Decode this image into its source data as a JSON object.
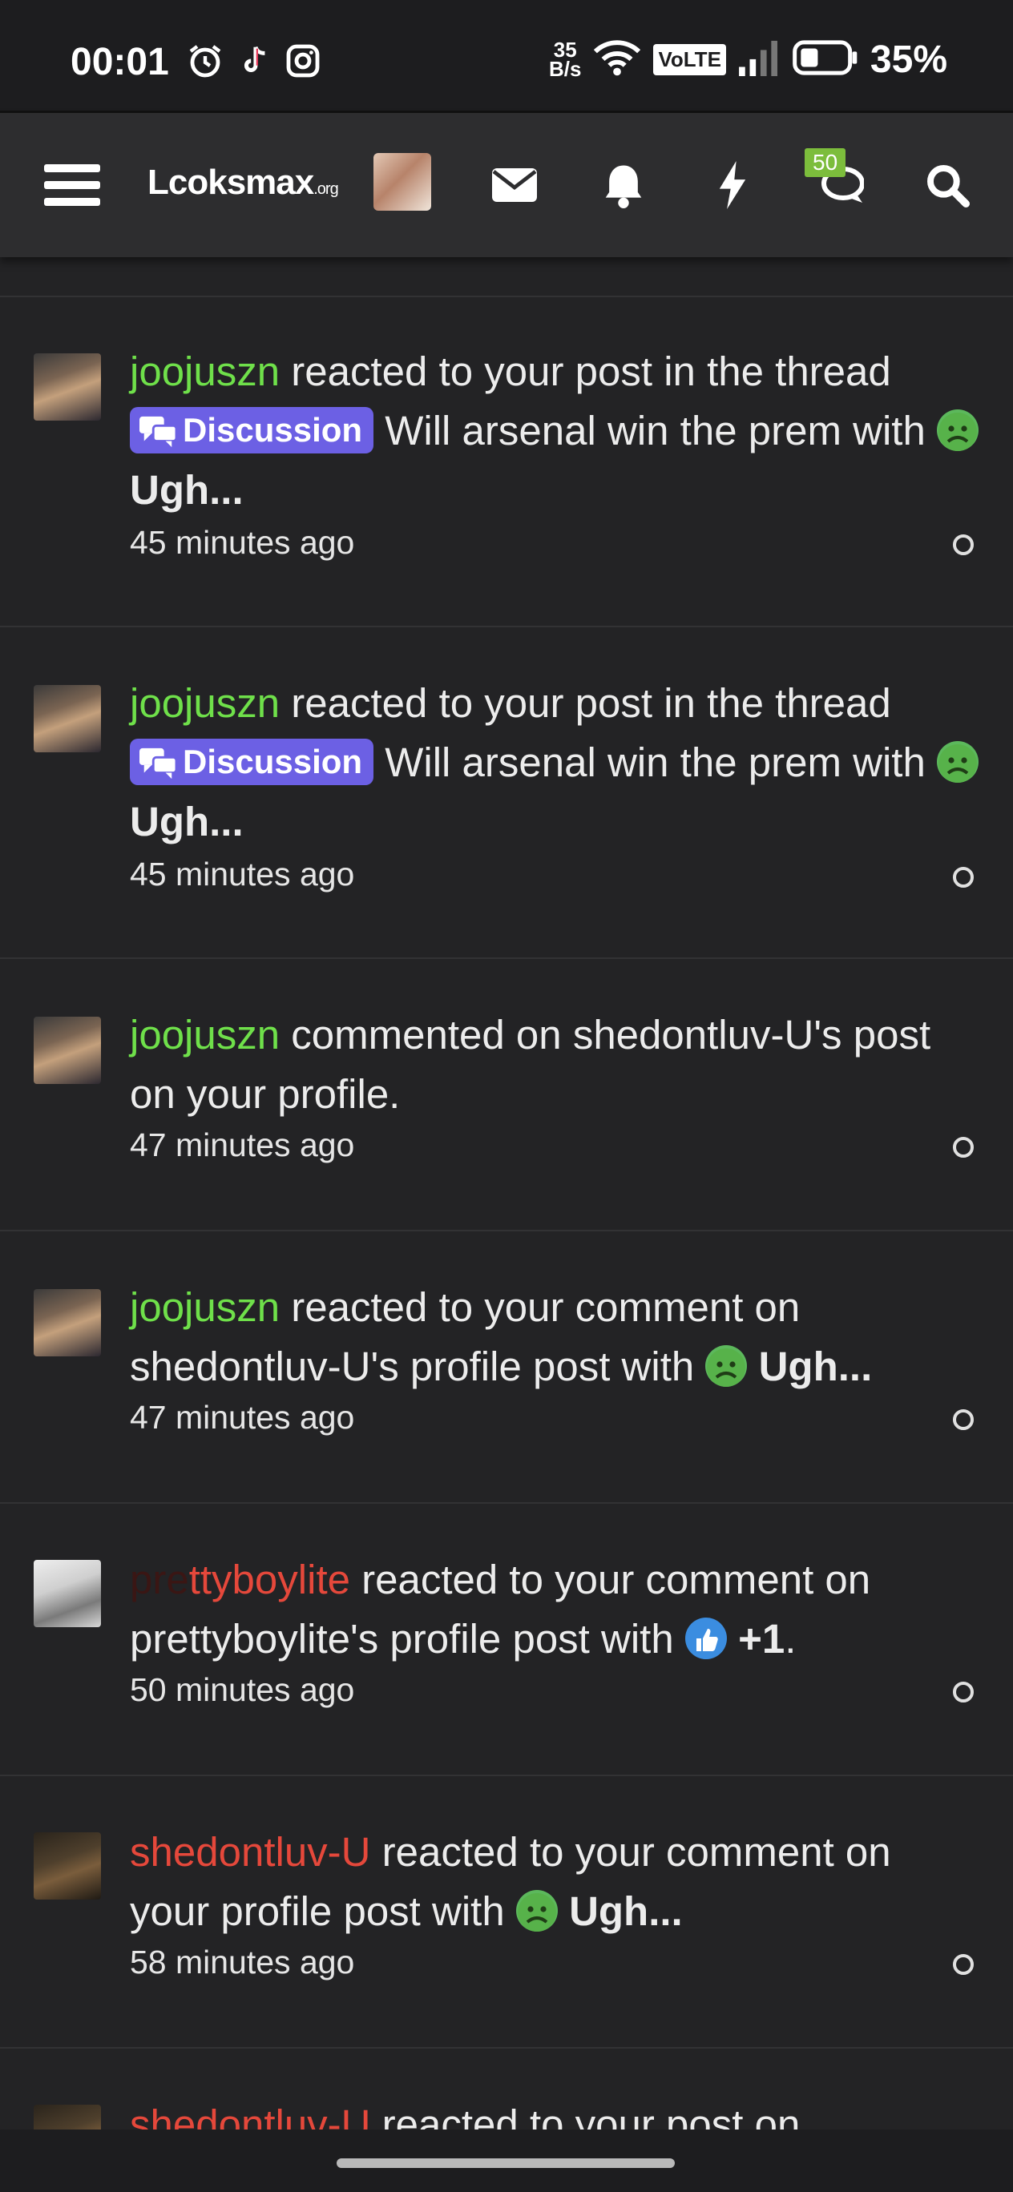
{
  "status": {
    "time": "00:01",
    "speed_top": "35",
    "speed_bottom": "B/s",
    "volte": "VoLTE",
    "battery": "35%"
  },
  "nav": {
    "logo_main": "Lcoksmax",
    "logo_suffix": ".org",
    "badge_count": "50"
  },
  "notifications": [
    {
      "user": "joojuszn",
      "text": "reacted to your post in the thread",
      "tag": "Discussion",
      "thread": "Will arsenal win the prem",
      "with": "with",
      "reaction": "Ugh...",
      "time": "45 minutes ago"
    },
    {
      "user": "joojuszn",
      "text": "reacted to your post in the thread",
      "tag": "Discussion",
      "thread": "Will arsenal win the prem",
      "with": "with",
      "reaction": "Ugh...",
      "time": "45 minutes ago"
    },
    {
      "user": "joojuszn",
      "text": "commented on shedontluv-U's post on your profile.",
      "time": "47 minutes ago"
    },
    {
      "user": "joojuszn",
      "text": "reacted to your comment on shedontluv-U's profile post with",
      "reaction": "Ugh...",
      "time": "47 minutes ago"
    },
    {
      "user_a": "pre",
      "user_b": "ttyboylite",
      "text": "reacted to your comment on prettyboylite's profile post with",
      "reaction": "+1",
      "after": ".",
      "time": "50 minutes ago"
    },
    {
      "user": "shedontluv-U",
      "text": "reacted to your comment on your profile post with",
      "reaction": "Ugh...",
      "time": "58 minutes ago"
    },
    {
      "user": "shedontluv-U",
      "text": "reacted to your post on"
    }
  ]
}
